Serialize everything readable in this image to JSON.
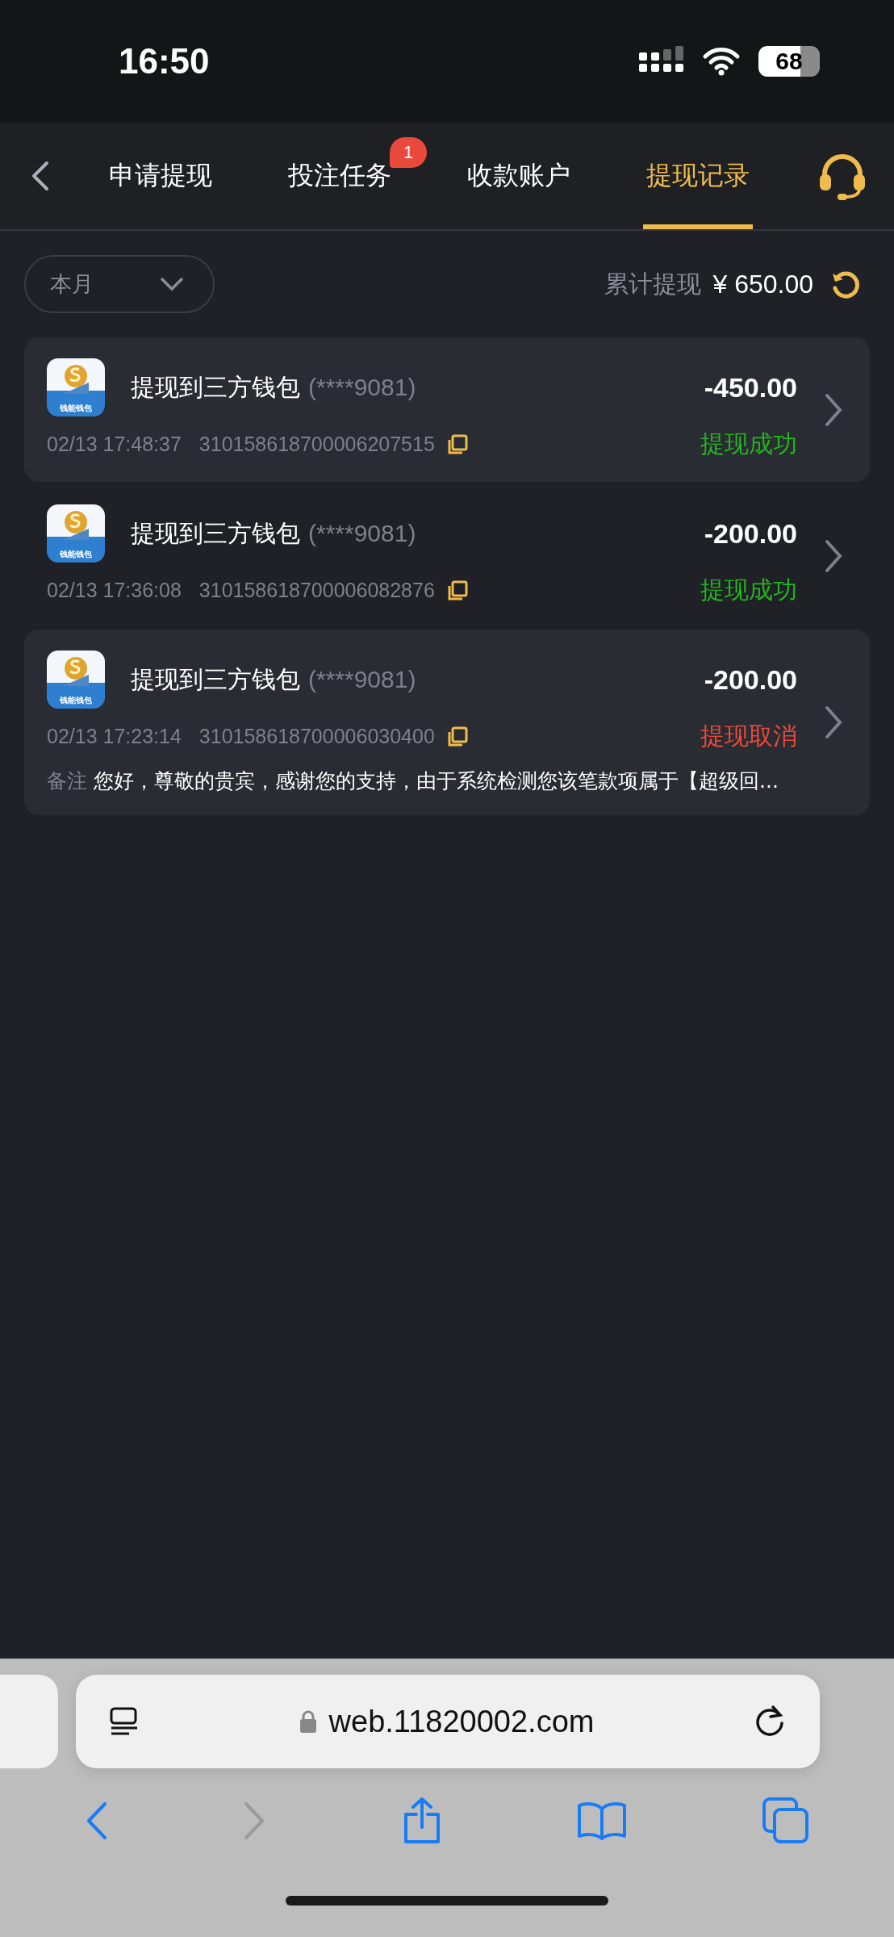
{
  "status_bar": {
    "time": "16:50",
    "battery": "68"
  },
  "tabs": [
    {
      "label": "申请提现",
      "selected": false
    },
    {
      "label": "投注任务",
      "selected": false,
      "badge": "1"
    },
    {
      "label": "收款账户",
      "selected": false
    },
    {
      "label": "提现记录",
      "selected": true
    }
  ],
  "filter": {
    "period": "本月"
  },
  "summary": {
    "label": "累计提现",
    "amount": "¥ 650.00"
  },
  "records": [
    {
      "logo_text": "钱能钱包",
      "title": "提现到三方钱包",
      "account": "(****9081)",
      "time": "02/13 17:48:37",
      "order_no": "310158618700006207515",
      "amount": "-450.00",
      "status": "提现成功",
      "kind": "success",
      "highlighted": true
    },
    {
      "logo_text": "钱能钱包",
      "title": "提现到三方钱包",
      "account": "(****9081)",
      "time": "02/13 17:36:08",
      "order_no": "310158618700006082876",
      "amount": "-200.00",
      "status": "提现成功",
      "kind": "success",
      "highlighted": false
    },
    {
      "logo_text": "钱能钱包",
      "title": "提现到三方钱包",
      "account": "(****9081)",
      "time": "02/13 17:23:14",
      "order_no": "310158618700006030400",
      "amount": "-200.00",
      "status": "提现取消",
      "kind": "cancelled",
      "highlighted": true,
      "note_label": "备注",
      "note": "您好，尊敬的贵宾，感谢您的支持，由于系统检测您该笔款项属于【超级回..."
    }
  ],
  "browser": {
    "url": "web.11820002.com"
  }
}
